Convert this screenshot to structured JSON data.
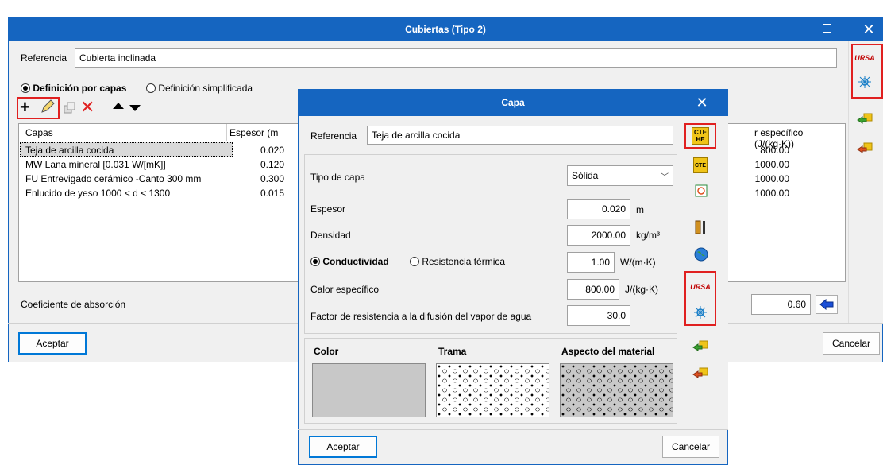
{
  "main_window": {
    "title": "Cubiertas (Tipo 2)",
    "referencia_label": "Referencia",
    "referencia_value": "Cubierta inclinada",
    "radio_capas": "Definición por capas",
    "radio_simplificada": "Definición simplificada",
    "columns": [
      "Capas",
      "Espesor (m",
      "r específico (J/(kg·K))"
    ],
    "rows": [
      {
        "name": "Teja de arcilla cocida",
        "espesor": "0.020",
        "calor": "800.00"
      },
      {
        "name": "MW Lana mineral [0.031 W/[mK]]",
        "espesor": "0.120",
        "calor": "1000.00"
      },
      {
        "name": "FU Entrevigado cerámico -Canto 300 mm",
        "espesor": "0.300",
        "calor": "1000.00"
      },
      {
        "name": "Enlucido de yeso 1000 < d < 1300",
        "espesor": "0.015",
        "calor": "1000.00"
      }
    ],
    "absorcion_label": "Coeficiente de absorción",
    "absorcion_value": "0.60",
    "aceptar": "Aceptar",
    "cancelar": "Cancelar"
  },
  "capa_dialog": {
    "title": "Capa",
    "referencia_label": "Referencia",
    "referencia_value": "Teja de arcilla cocida",
    "tipo_label": "Tipo de capa",
    "tipo_value": "Sólida",
    "espesor_label": "Espesor",
    "espesor_value": "0.020",
    "espesor_unit": "m",
    "densidad_label": "Densidad",
    "densidad_value": "2000.00",
    "densidad_unit": "kg/m³",
    "radio_conductividad": "Conductividad",
    "radio_resistencia": "Resistencia térmica",
    "conductividad_value": "1.00",
    "conductividad_unit": "W/(m·K)",
    "calor_label": "Calor específico",
    "calor_value": "800.00",
    "calor_unit": "J/(kg·K)",
    "vapor_label": "Factor de resistencia a la difusión del vapor de agua",
    "vapor_value": "30.0",
    "color_header": "Color",
    "trama_header": "Trama",
    "aspecto_header": "Aspecto del material",
    "aceptar": "Aceptar",
    "cancelar": "Cancelar"
  },
  "icons": {
    "cte_he": "CTE HE",
    "cte": "CTE",
    "ursa": "URSA"
  },
  "colors": {
    "titlebar": "#1565c0",
    "highlight_red": "#e02020",
    "selected_row": "#d9d9d9"
  }
}
